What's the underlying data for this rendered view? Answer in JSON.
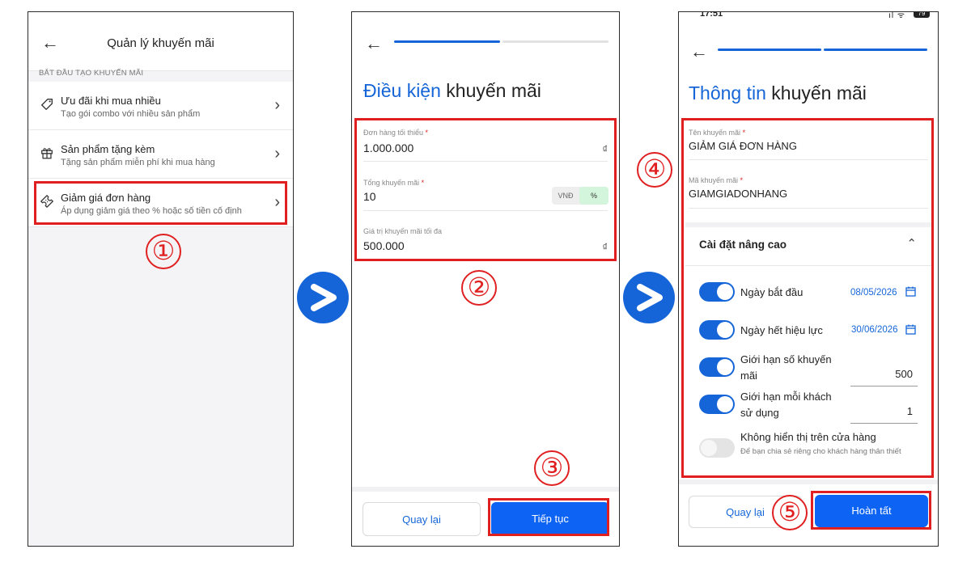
{
  "panel1": {
    "title": "Quản lý khuyến mãi",
    "section_label": "BẮT ĐẦU TẠO KHUYẾN MÃI",
    "items": [
      {
        "title": "Ưu đãi khi mua nhiều",
        "subtitle": "Tạo gói combo với nhiều sản phẩm",
        "icon": "tag-icon"
      },
      {
        "title": "Sản phẩm tặng kèm",
        "subtitle": "Tặng sản phẩm miễn phí khi mua hàng",
        "icon": "gift-icon"
      },
      {
        "title": "Giảm giá đơn hàng",
        "subtitle": "Áp dụng giảm giá theo % hoặc số tiền cố định",
        "icon": "ticket-icon"
      }
    ],
    "step_marker": "①"
  },
  "panel2": {
    "title_accent": "Điều kiện",
    "title_rest": " khuyến mãi",
    "progress": {
      "step": 1,
      "of": 2
    },
    "fields": {
      "min_order": {
        "label": "Đơn hàng tối thiểu",
        "value": "1.000.000",
        "currency": "₫"
      },
      "total_discount": {
        "label": "Tổng khuyến mãi",
        "value": "10",
        "unit_options": [
          "VNĐ",
          "%"
        ],
        "selected_unit": "%"
      },
      "max_discount": {
        "label": "Giá trị khuyến mãi tối đa",
        "value": "500.000",
        "currency": "₫"
      }
    },
    "required_mark": "*",
    "back_button": "Quay lại",
    "next_button": "Tiếp tục",
    "step_marker_fields": "②",
    "step_marker_next": "③"
  },
  "panel3": {
    "status_time": "17:51",
    "status_battery": "79",
    "title_accent": "Thông tin",
    "title_rest": " khuyến mãi",
    "progress": {
      "step": 2,
      "of": 2
    },
    "fields": {
      "name": {
        "label": "Tên khuyến mãi",
        "value": "GIẢM GIÁ ĐƠN HÀNG"
      },
      "code": {
        "label": "Mã khuyến mãi",
        "value": "GIAMGIADONHANG"
      }
    },
    "required_mark": "*",
    "advanced_label": "Cài đặt nâng cao",
    "settings": {
      "start_date": {
        "label": "Ngày bắt đầu",
        "value": "08/05/2026",
        "enabled": true
      },
      "end_date": {
        "label": "Ngày hết hiệu lực",
        "value": "30/06/2026",
        "enabled": true
      },
      "limit_total": {
        "label": "Giới hạn số khuyến mãi",
        "value": "500",
        "enabled": true
      },
      "limit_per_customer": {
        "label": "Giới hạn mỗi khách sử dụng",
        "value": "1",
        "enabled": true
      },
      "hide_in_store": {
        "label": "Không hiển thị trên cửa hàng",
        "subtitle": "Để bạn chia sẻ riêng cho khách hàng thân thiết",
        "enabled": false
      }
    },
    "back_button": "Quay lại",
    "finish_button": "Hoàn tất",
    "step_marker_fields": "④",
    "step_marker_finish": "⑤"
  },
  "colors": {
    "accent": "#1565d8",
    "primary_button": "#0d63f3",
    "highlight": "#e02020"
  }
}
